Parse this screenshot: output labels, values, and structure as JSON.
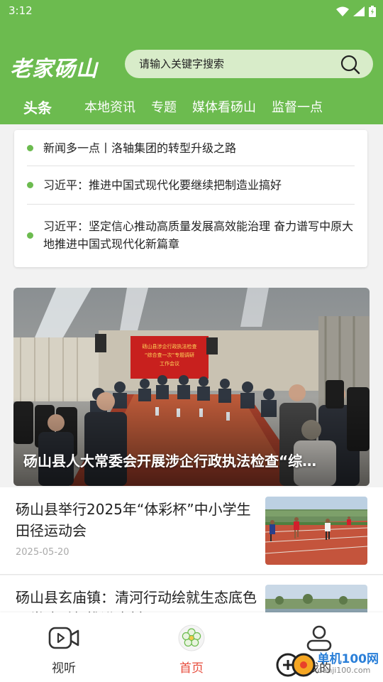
{
  "status_bar": {
    "time": "3:12"
  },
  "header": {
    "logo_text": "老家砀山",
    "search_placeholder": "请输入关键字搜索",
    "search_icon": "search-icon"
  },
  "tabs": [
    {
      "label": "头条",
      "active": true
    },
    {
      "label": "本地资讯",
      "active": false
    },
    {
      "label": "专题",
      "active": false
    },
    {
      "label": "媒体看砀山",
      "active": false
    },
    {
      "label": "监督一点",
      "active": false
    }
  ],
  "headlines": [
    "新闻多一点丨洛轴集团的转型升级之路",
    "习近平：推进中国式现代化要继续把制造业搞好",
    "习近平：坚定信心推动高质量发展高效能治理 奋力谱写中原大地推进中国式现代化新篇章"
  ],
  "hero": {
    "title": "砀山县人大常委会开展涉企行政执法检查“综…",
    "banner_text": "砀山县涉企行政执法检查“综合查一次”专题调研工作会议"
  },
  "news": [
    {
      "title": "砀山县举行2025年“体彩杯”中小学生田径运动会",
      "date": "2025-05-20"
    },
    {
      "title": "砀山县玄庙镇：清河行动绘就生态底色 以党建引领推进农村",
      "date": ""
    }
  ],
  "bottom_nav": [
    {
      "label": "视听",
      "icon": "video-camera-icon"
    },
    {
      "label": "首页",
      "icon": "flower-home-icon",
      "active": true
    },
    {
      "label": "我的",
      "icon": "user-icon"
    }
  ],
  "watermark": {
    "text": "单机100网",
    "sub": "danji100.com"
  },
  "colors": {
    "brand_green": "#6cbb4f",
    "active_red": "#e74c3c"
  }
}
